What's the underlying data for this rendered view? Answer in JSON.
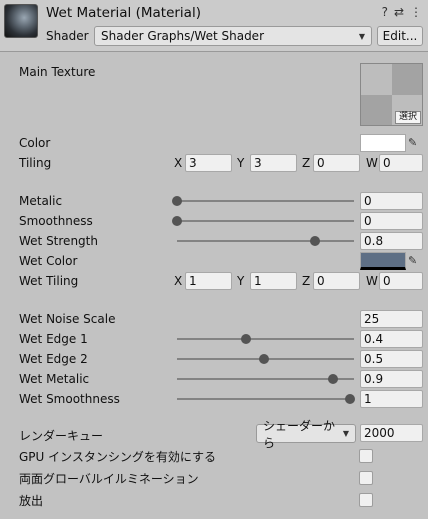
{
  "header": {
    "title": "Wet Material (Material)",
    "shader_label": "Shader",
    "shader_value": "Shader Graphs/Wet Shader",
    "edit_label": "Edit...",
    "help_icon": "?",
    "settings_icon": "⇄",
    "menu_icon": "⋮"
  },
  "main_texture": {
    "label": "Main Texture",
    "select_label": "選択"
  },
  "color": {
    "label": "Color",
    "value_hex": "#ffffff"
  },
  "tiling": {
    "label": "Tiling",
    "x_label": "X",
    "x": "3",
    "y_label": "Y",
    "y": "3",
    "z_label": "Z",
    "z": "0",
    "w_label": "W",
    "w": "0"
  },
  "metalic": {
    "label": "Metalic",
    "value": "0",
    "fraction": 0.0
  },
  "smoothness": {
    "label": "Smoothness",
    "value": "0",
    "fraction": 0.0
  },
  "wet_strength": {
    "label": "Wet Strength",
    "value": "0.8",
    "fraction": 0.8
  },
  "wet_color": {
    "label": "Wet Color",
    "value_hex": "#5e6f85"
  },
  "wet_tiling": {
    "label": "Wet Tiling",
    "x_label": "X",
    "x": "1",
    "y_label": "Y",
    "y": "1",
    "z_label": "Z",
    "z": "0",
    "w_label": "W",
    "w": "0"
  },
  "wet_noise_scale": {
    "label": "Wet Noise Scale",
    "value": "25"
  },
  "wet_edge1": {
    "label": "Wet Edge 1",
    "value": "0.4",
    "fraction": 0.4
  },
  "wet_edge2": {
    "label": "Wet Edge 2",
    "value": "0.5",
    "fraction": 0.5
  },
  "wet_metalic": {
    "label": "Wet Metalic",
    "value": "0.9",
    "fraction": 0.9
  },
  "wet_smoothness": {
    "label": "Wet Smoothness",
    "value": "1",
    "fraction": 1.0
  },
  "render_queue": {
    "label": "レンダーキュー",
    "mode": "シェーダーから",
    "value": "2000"
  },
  "gpu_instancing": {
    "label": "GPU インスタンシングを有効にする"
  },
  "double_sided_gi": {
    "label": "両面グローバルイルミネーション"
  },
  "emission": {
    "label": "放出"
  }
}
